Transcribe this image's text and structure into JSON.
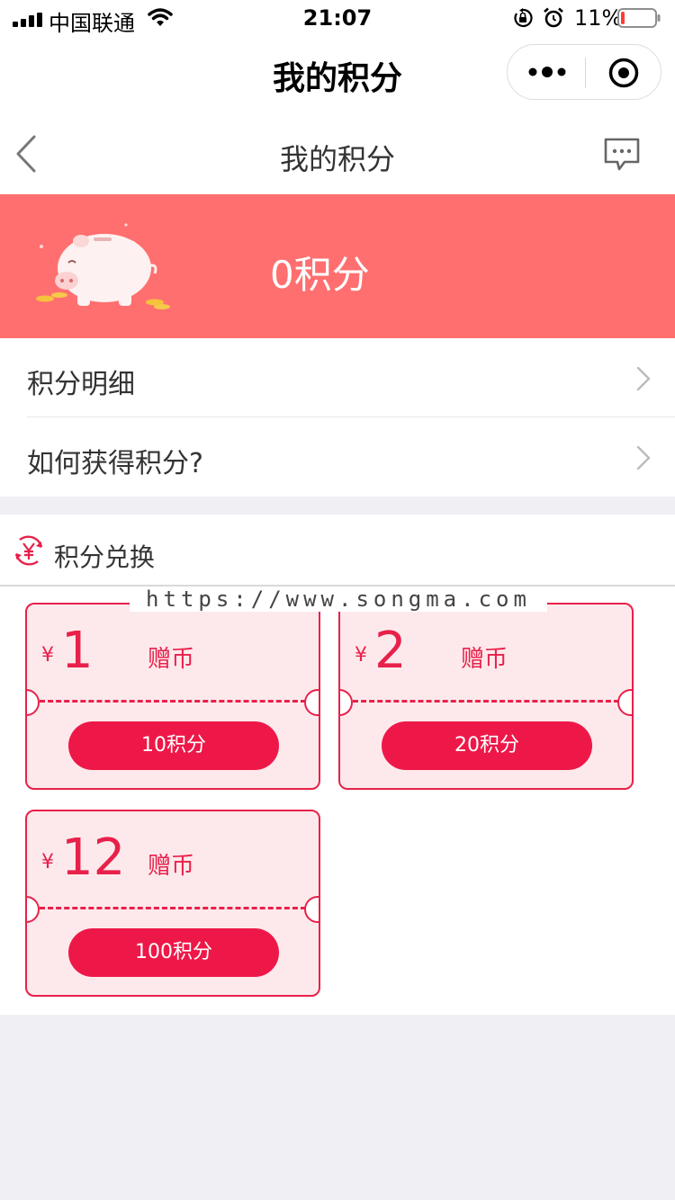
{
  "status_bar": {
    "carrier": "中国联通",
    "time": "21:07",
    "battery": "11%",
    "battery_level": 0.11
  },
  "mp_nav": {
    "title": "我的积分"
  },
  "header": {
    "title": "我的积分"
  },
  "banner": {
    "points": "0积分"
  },
  "menu": {
    "items": [
      {
        "label": "积分明细"
      },
      {
        "label": "如何获得积分?"
      }
    ]
  },
  "exchange": {
    "title": "积分兑换",
    "watermark": "https://www.songma.com",
    "coupons": [
      {
        "currency": "¥",
        "amount": "1",
        "type": "赠币",
        "button": "10积分"
      },
      {
        "currency": "¥",
        "amount": "2",
        "type": "赠币",
        "button": "20积分"
      },
      {
        "currency": "¥",
        "amount": "12",
        "type": "赠币",
        "button": "100积分"
      }
    ]
  },
  "colors": {
    "banner": "#ff6f6f",
    "accent": "#e8214a",
    "button": "#ee1848",
    "coupon_bg": "#fde9ec",
    "page_bg": "#efeff4"
  },
  "icons": [
    "signal-icon",
    "wifi-icon",
    "orientation-lock-icon",
    "alarm-icon",
    "battery-icon",
    "more-dots-icon",
    "target-icon",
    "back-chevron-icon",
    "message-icon",
    "piggy-bank-icon",
    "chevron-right-icon",
    "yen-exchange-icon"
  ]
}
